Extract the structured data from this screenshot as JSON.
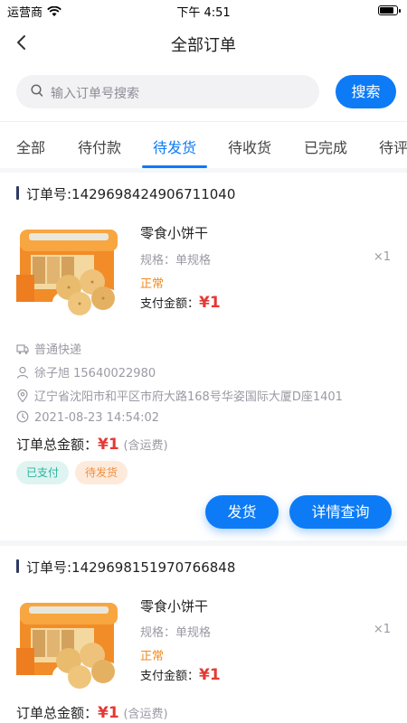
{
  "status_bar": {
    "carrier": "运营商",
    "time": "下午 4:51",
    "battery_level": 0.9
  },
  "nav": {
    "title": "全部订单",
    "back_icon": "chevron-left-icon"
  },
  "search": {
    "placeholder": "输入订单号搜索",
    "button_label": "搜索"
  },
  "tabs": [
    {
      "label": "全部"
    },
    {
      "label": "待付款"
    },
    {
      "label": "待发货",
      "active": true
    },
    {
      "label": "待收货"
    },
    {
      "label": "已完成"
    },
    {
      "label": "待评"
    }
  ],
  "orders": [
    {
      "order_no": "订单号:1429698424906711040",
      "product": {
        "name": "零食小饼干",
        "spec": "规格：单规格",
        "qty": "×1",
        "status": "正常",
        "pay_label": "支付金额：",
        "pay_amount": "¥1"
      },
      "delivery": "普通快递",
      "contact": "徐子旭 15640022980",
      "address": "辽宁省沈阳市和平区市府大路168号华姿国际大厦D座1401",
      "time": "2021-08-23 14:54:02",
      "total_label": "订单总金额：",
      "total_amount": "¥1",
      "total_note": "(含运费)",
      "tags": [
        "已支付",
        "待发货"
      ],
      "buttons": {
        "ship": "发货",
        "detail": "详情查询"
      }
    },
    {
      "order_no": "订单号:1429698151970766848",
      "product": {
        "name": "零食小饼干",
        "spec": "规格：单规格",
        "qty": "×1",
        "status": "正常",
        "pay_label": "支付金额：",
        "pay_amount": "¥1"
      },
      "total_label": "订单总金额：",
      "total_amount": "¥1",
      "total_note": "(含运费)"
    }
  ],
  "colors": {
    "accent": "#0d7bf5",
    "price": "#e53935",
    "status_orange": "#f08a1c"
  }
}
